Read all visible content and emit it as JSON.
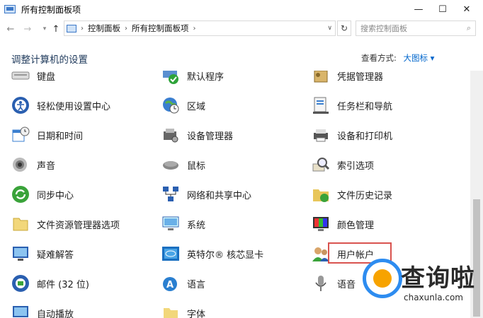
{
  "window": {
    "title": "所有控制面板项",
    "minimize": "—",
    "maximize": "☐",
    "close": "✕"
  },
  "nav": {
    "back": "←",
    "forward": "→",
    "recent": "▾",
    "up": "↑",
    "breadcrumb": [
      "控制面板",
      "所有控制面板项"
    ],
    "breadcrumb_sep": "›",
    "address_drop": "∨",
    "refresh": "↻",
    "search_placeholder": "搜索控制面板",
    "search_icon": "⌕"
  },
  "header": {
    "title": "调整计算机的设置",
    "view_label": "查看方式:",
    "view_value": "大图标 ▾"
  },
  "items": [
    {
      "label": "键盘",
      "icon": "keyboard-icon"
    },
    {
      "label": "默认程序",
      "icon": "default-programs-icon"
    },
    {
      "label": "凭据管理器",
      "icon": "credential-manager-icon"
    },
    {
      "label": "轻松使用设置中心",
      "icon": "ease-of-access-icon"
    },
    {
      "label": "区域",
      "icon": "region-icon"
    },
    {
      "label": "任务栏和导航",
      "icon": "taskbar-icon"
    },
    {
      "label": "日期和时间",
      "icon": "date-time-icon"
    },
    {
      "label": "设备管理器",
      "icon": "device-manager-icon"
    },
    {
      "label": "设备和打印机",
      "icon": "printer-icon"
    },
    {
      "label": "声音",
      "icon": "sound-icon"
    },
    {
      "label": "鼠标",
      "icon": "mouse-icon"
    },
    {
      "label": "索引选项",
      "icon": "indexing-icon"
    },
    {
      "label": "同步中心",
      "icon": "sync-center-icon"
    },
    {
      "label": "网络和共享中心",
      "icon": "network-icon"
    },
    {
      "label": "文件历史记录",
      "icon": "file-history-icon"
    },
    {
      "label": "文件资源管理器选项",
      "icon": "folder-options-icon"
    },
    {
      "label": "系统",
      "icon": "system-icon"
    },
    {
      "label": "颜色管理",
      "icon": "color-management-icon"
    },
    {
      "label": "疑难解答",
      "icon": "troubleshooting-icon"
    },
    {
      "label": "英特尔® 核芯显卡",
      "icon": "intel-graphics-icon"
    },
    {
      "label": "用户帐户",
      "icon": "user-accounts-icon"
    },
    {
      "label": "邮件 (32 位)",
      "icon": "mail-icon"
    },
    {
      "label": "语言",
      "icon": "language-icon"
    },
    {
      "label": "语音",
      "icon": "speech-icon"
    },
    {
      "label": "自动播放",
      "icon": "autoplay-icon"
    },
    {
      "label": "字体",
      "icon": "fonts-icon"
    }
  ],
  "watermark": {
    "text": "查询啦",
    "url": "chaxunla.com"
  },
  "colors": {
    "accent": "#0066cc",
    "highlight_border": "#d9534f",
    "heading": "#1e395b"
  }
}
